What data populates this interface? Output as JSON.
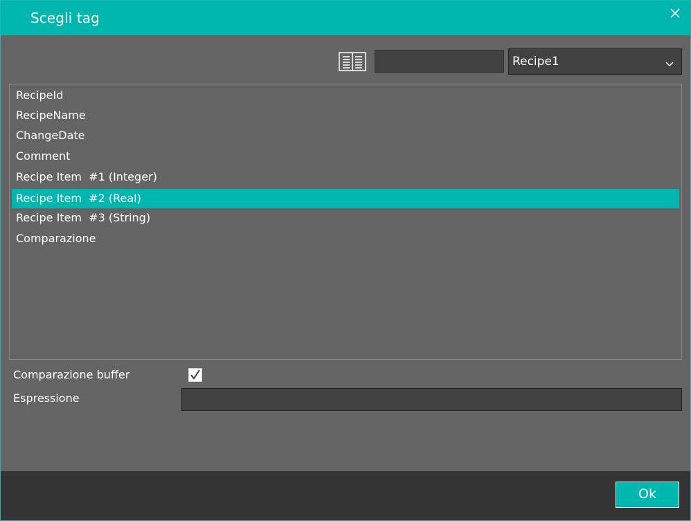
{
  "dialog": {
    "title": "Scegli tag",
    "close_icon": "close-icon"
  },
  "toolbar": {
    "view_icon": "book-icon",
    "search_value": "",
    "recipe_select": {
      "value": "Recipe1",
      "chevron_icon": "chevron-down-icon"
    }
  },
  "tags": [
    {
      "label": "RecipeId",
      "selected": false
    },
    {
      "label": "RecipeName",
      "selected": false
    },
    {
      "label": "ChangeDate",
      "selected": false
    },
    {
      "label": "Comment",
      "selected": false
    },
    {
      "label": "Recipe Item  #1 (Integer)",
      "selected": false
    },
    {
      "label": "Recipe Item  #2 (Real)",
      "selected": true
    },
    {
      "label": "Recipe Item  #3 (String)",
      "selected": false
    },
    {
      "label": "Comparazione",
      "selected": false
    }
  ],
  "options": {
    "buffer_compare_label": "Comparazione buffer",
    "buffer_compare_checked": true,
    "expression_label": "Espressione",
    "expression_value": ""
  },
  "footer": {
    "ok_label": "Ok"
  },
  "colors": {
    "accent": "#00b7b0",
    "background": "#646464",
    "input": "#424242",
    "footer": "#353535"
  }
}
